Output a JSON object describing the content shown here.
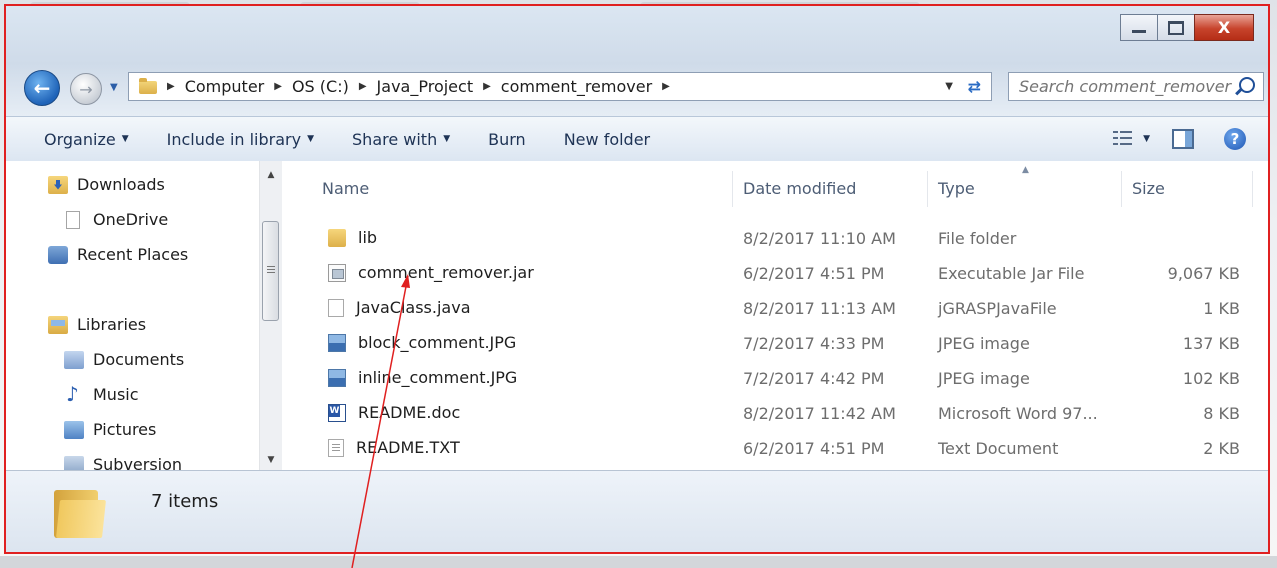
{
  "window": {
    "title_buttons": {
      "minimize": "minimize",
      "maximize": "maximize",
      "close": "X"
    }
  },
  "address_bar": {
    "crumbs": [
      "Computer",
      "OS (C:)",
      "Java_Project",
      "comment_remover"
    ],
    "search_placeholder": "Search comment_remover"
  },
  "toolbar": {
    "organize": "Organize",
    "include_in_library": "Include in library",
    "share_with": "Share with",
    "burn": "Burn",
    "new_folder": "New folder"
  },
  "nav_pane": {
    "items": [
      {
        "label": "Downloads",
        "icon": "downloads-icon"
      },
      {
        "label": "OneDrive",
        "icon": "onedrive-icon"
      },
      {
        "label": "Recent Places",
        "icon": "recent-places-icon"
      },
      {
        "label": "Libraries",
        "icon": "libraries-icon"
      },
      {
        "label": "Documents",
        "icon": "documents-icon"
      },
      {
        "label": "Music",
        "icon": "music-icon"
      },
      {
        "label": "Pictures",
        "icon": "pictures-icon"
      },
      {
        "label": "Subversion",
        "icon": "subversion-icon"
      }
    ]
  },
  "file_list": {
    "columns": {
      "name": "Name",
      "date": "Date modified",
      "type": "Type",
      "size": "Size"
    },
    "rows": [
      {
        "name": "lib",
        "date": "8/2/2017 11:10 AM",
        "type": "File folder",
        "size": "",
        "icon": "folder-icon"
      },
      {
        "name": "comment_remover.jar",
        "date": "6/2/2017 4:51 PM",
        "type": "Executable Jar File",
        "size": "9,067 KB",
        "icon": "jar-file-icon"
      },
      {
        "name": "JavaClass.java",
        "date": "8/2/2017 11:13 AM",
        "type": "jGRASPJavaFile",
        "size": "1 KB",
        "icon": "java-file-icon"
      },
      {
        "name": "block_comment.JPG",
        "date": "7/2/2017 4:33 PM",
        "type": "JPEG image",
        "size": "137 KB",
        "icon": "jpeg-file-icon"
      },
      {
        "name": "inline_comment.JPG",
        "date": "7/2/2017 4:42 PM",
        "type": "JPEG image",
        "size": "102 KB",
        "icon": "jpeg-file-icon"
      },
      {
        "name": "README.doc",
        "date": "8/2/2017 11:42 AM",
        "type": "Microsoft Word 97...",
        "size": "8 KB",
        "icon": "word-doc-icon"
      },
      {
        "name": "README.TXT",
        "date": "6/2/2017 4:51 PM",
        "type": "Text Document",
        "size": "2 KB",
        "icon": "text-file-icon"
      }
    ]
  },
  "details_pane": {
    "item_count": "7 items"
  },
  "colors": {
    "highlight_border": "#e02020",
    "annotation_arrow": "#e02020"
  }
}
